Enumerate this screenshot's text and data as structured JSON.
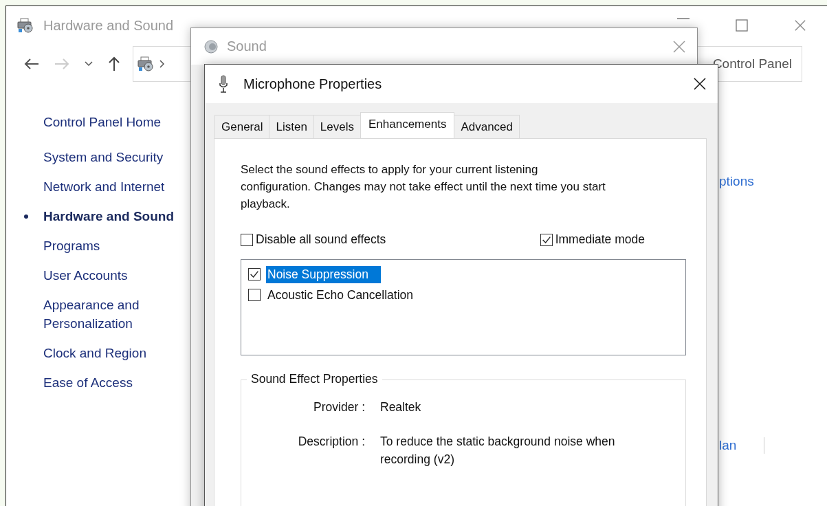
{
  "control_panel": {
    "title": "Hardware and Sound",
    "address": "Control Panel",
    "home_link": "Control Panel Home",
    "sidebar": {
      "items": [
        {
          "label": "System and Security",
          "selected": false
        },
        {
          "label": "Network and Internet",
          "selected": false
        },
        {
          "label": "Hardware and Sound",
          "selected": true
        },
        {
          "label": "Programs",
          "selected": false
        },
        {
          "label": "User Accounts",
          "selected": false
        },
        {
          "label": "Appearance and Personalization",
          "selected": false
        },
        {
          "label": "Clock and Region",
          "selected": false
        },
        {
          "label": "Ease of Access",
          "selected": false
        }
      ]
    },
    "links": [
      "ptions",
      "lan"
    ]
  },
  "sound_dialog": {
    "title": "Sound"
  },
  "mic_dialog": {
    "title": "Microphone Properties",
    "tabs": [
      {
        "label": "General",
        "selected": false
      },
      {
        "label": "Listen",
        "selected": false
      },
      {
        "label": "Levels",
        "selected": false
      },
      {
        "label": "Enhancements",
        "selected": true
      },
      {
        "label": "Advanced",
        "selected": false
      }
    ],
    "description_lines": [
      "Select the sound effects to apply for your current listening",
      "configuration. Changes may not take effect until the next time you start",
      "playback."
    ],
    "options": [
      {
        "label": "Disable all sound effects",
        "checked": false
      },
      {
        "label": "Immediate mode",
        "checked": true
      }
    ],
    "effects": [
      {
        "label": "Noise Suppression",
        "checked": true,
        "selected": true
      },
      {
        "label": "Acoustic Echo Cancellation",
        "checked": false,
        "selected": false
      }
    ],
    "group": {
      "title": "Sound Effect Properties",
      "rows": [
        {
          "label": "Provider :",
          "value_lines": [
            "Realtek"
          ]
        },
        {
          "label": "Description :",
          "value_lines": [
            "To reduce the static background noise when",
            "recording (v2)"
          ]
        }
      ]
    }
  }
}
